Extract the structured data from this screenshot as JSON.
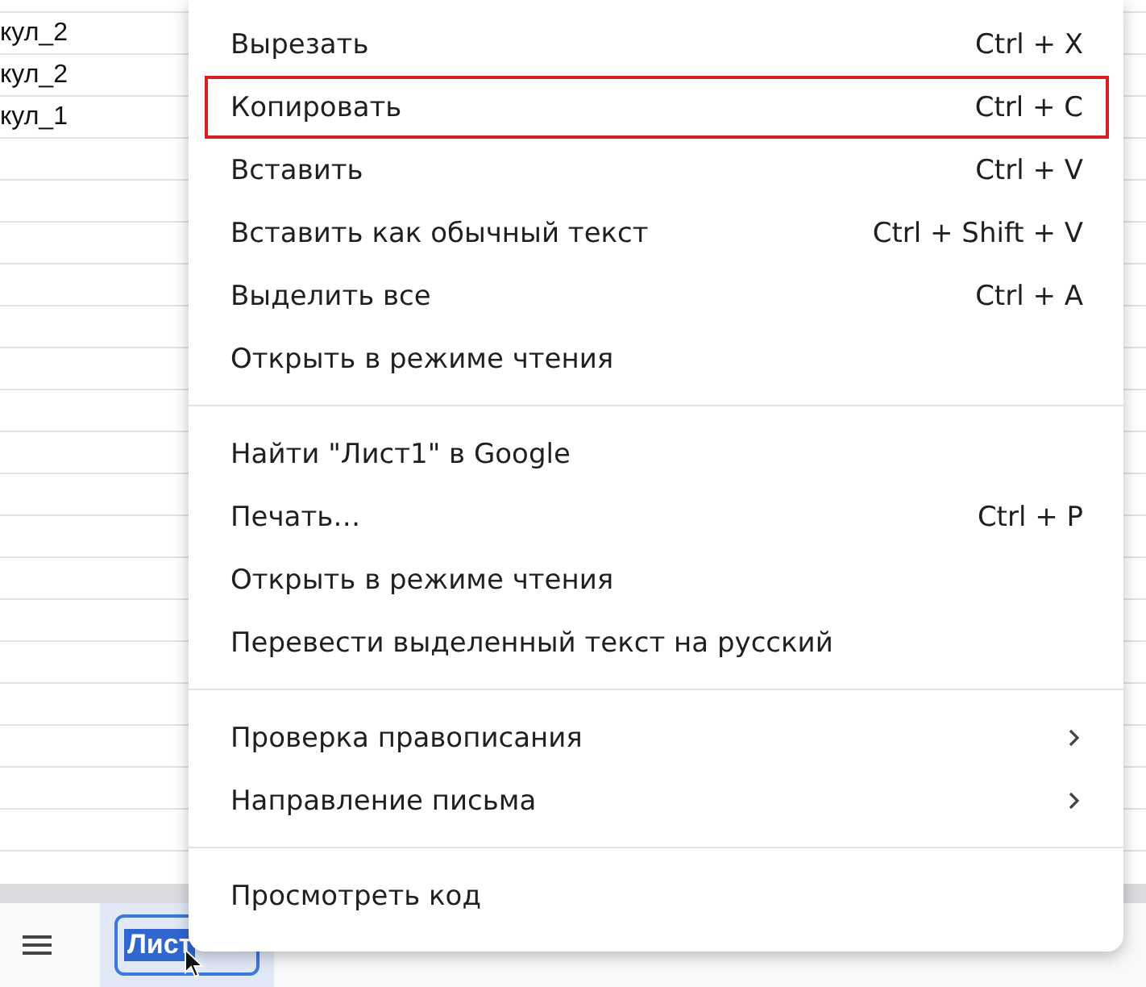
{
  "sheet": {
    "cells": [
      "кул_2",
      "кул_2",
      "кул_1"
    ]
  },
  "sheet_tabs": [
    {
      "label": "Лист",
      "selected": true
    }
  ],
  "context_menu": {
    "groups": [
      [
        {
          "label": "Вырезать",
          "shortcut": "Ctrl + X",
          "highlighted": false,
          "submenu": false
        },
        {
          "label": "Копировать",
          "shortcut": "Ctrl + C",
          "highlighted": true,
          "submenu": false
        },
        {
          "label": "Вставить",
          "shortcut": "Ctrl + V",
          "highlighted": false,
          "submenu": false
        },
        {
          "label": "Вставить как обычный текст",
          "shortcut": "Ctrl + Shift + V",
          "highlighted": false,
          "submenu": false
        },
        {
          "label": "Выделить все",
          "shortcut": "Ctrl + A",
          "highlighted": false,
          "submenu": false
        },
        {
          "label": "Открыть в режиме чтения",
          "highlighted": false,
          "submenu": false
        }
      ],
      [
        {
          "label": "Найти \"Лист1\" в Google",
          "highlighted": false,
          "submenu": false
        },
        {
          "label": "Печать…",
          "shortcut": "Ctrl + P",
          "highlighted": false,
          "submenu": false
        },
        {
          "label": "Открыть в режиме чтения",
          "highlighted": false,
          "submenu": false
        },
        {
          "label": "Перевести выделенный текст на русский",
          "highlighted": false,
          "submenu": false
        }
      ],
      [
        {
          "label": "Проверка правописания",
          "highlighted": false,
          "submenu": true
        },
        {
          "label": "Направление письма",
          "highlighted": false,
          "submenu": true
        }
      ],
      [
        {
          "label": "Просмотреть код",
          "highlighted": false,
          "submenu": false
        }
      ]
    ]
  }
}
